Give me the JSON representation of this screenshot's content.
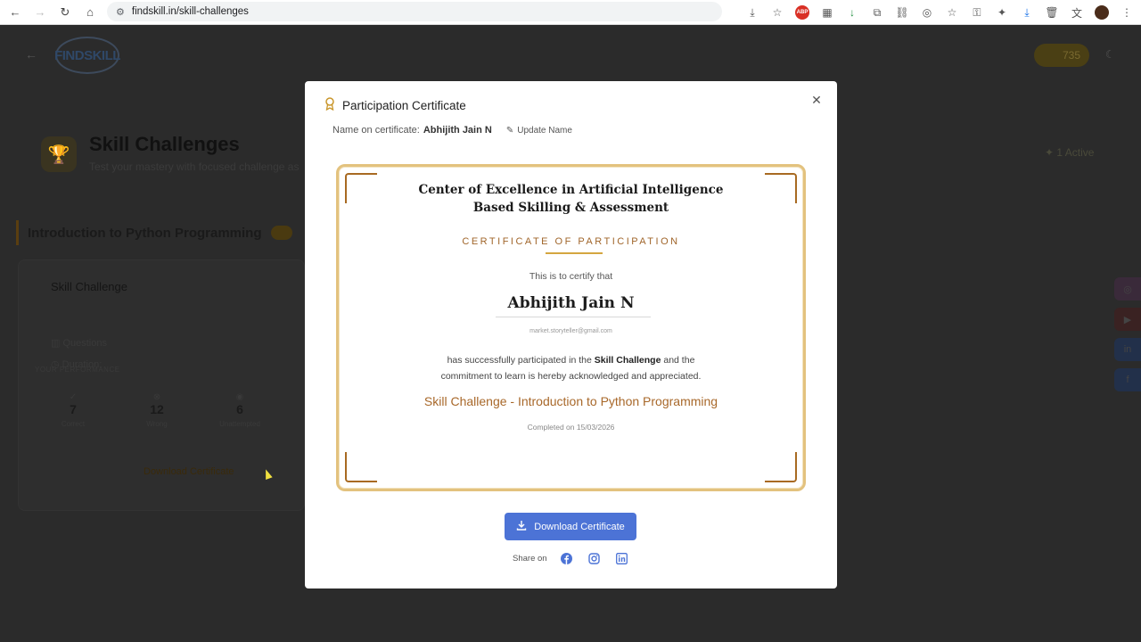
{
  "browser": {
    "url": "findskill.in/skill-challenges"
  },
  "background": {
    "logo_text": "FINDSKILL",
    "coins": "735",
    "page_title": "Skill Challenges",
    "page_subtitle": "Test your mastery with focused challenge as",
    "active_count": "1 Active",
    "course_title": "Introduction to Python Programming",
    "card": {
      "title": "Skill Challenge",
      "questions_label": "Questions",
      "duration_label": "Duration:",
      "performance_label": "YOUR PERFORMANCE",
      "stats": [
        {
          "value": "7",
          "label": "Correct"
        },
        {
          "value": "12",
          "label": "Wrong"
        },
        {
          "value": "6",
          "label": "Unattempted"
        }
      ],
      "download_label": "Download Certificate"
    }
  },
  "modal": {
    "title": "Participation Certificate",
    "name_label": "Name on certificate:",
    "name_value": "Abhijith Jain N",
    "update_label": "Update Name",
    "download_label": "Download Certificate",
    "share_label": "Share on"
  },
  "certificate": {
    "org_line1": "Center of Excellence in Artificial Intelligence",
    "org_line2": "Based Skilling & Assessment",
    "type": "CERTIFICATE OF PARTICIPATION",
    "certify": "This is to certify that",
    "recipient": "Abhijith Jain N",
    "email": "market.storyteller@gmail.com",
    "body_pre": "has successfully participated in the",
    "body_bold": "Skill Challenge",
    "body_post": "and the",
    "body_line2": "commitment to learn is hereby acknowledged and appreciated.",
    "challenge": "Skill Challenge - Introduction to Python Programming",
    "completed": "Completed on 15/03/2026"
  },
  "colors": {
    "accent_blue": "#4c73d6",
    "gold_border": "#e3c27e",
    "bronze_text": "#a8682a"
  }
}
